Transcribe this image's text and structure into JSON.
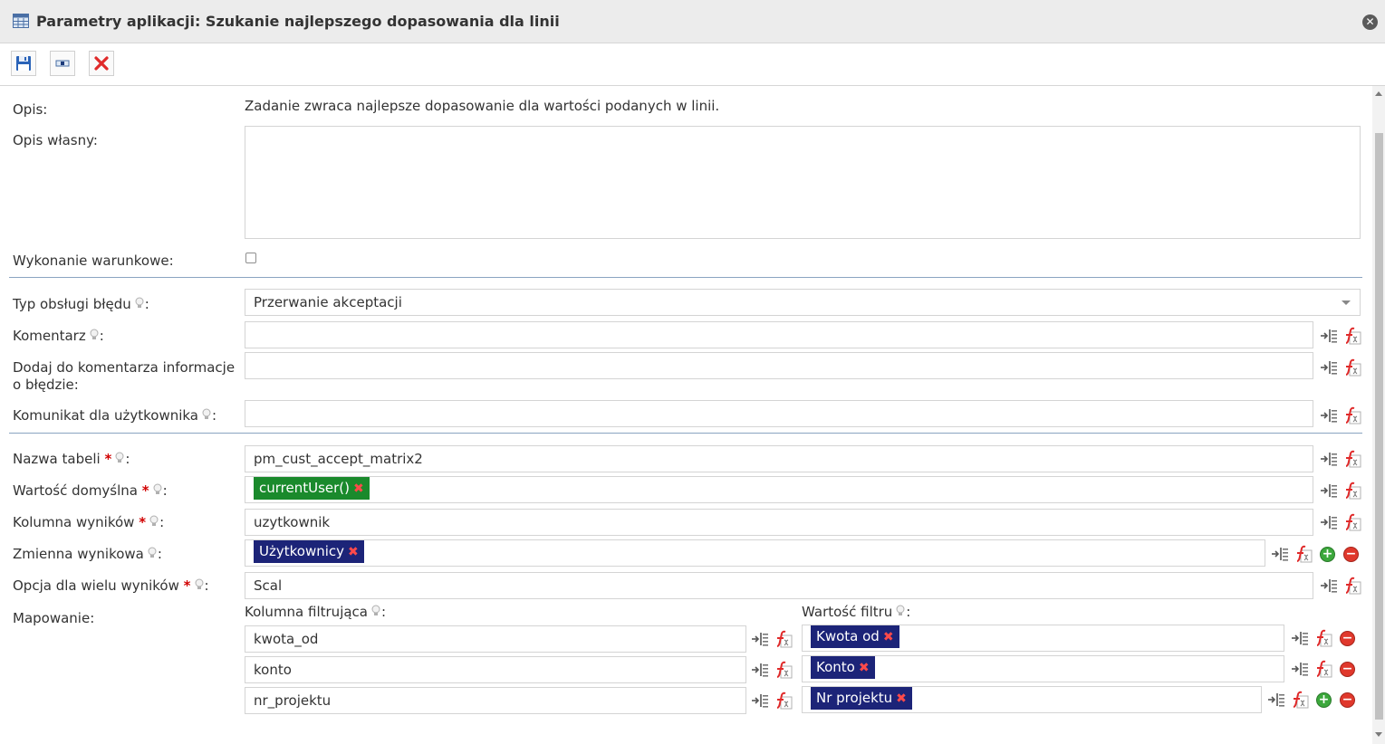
{
  "window": {
    "title": "Parametry aplikacji: Szukanie najlepszego dopasowania dla linii"
  },
  "toolbar": {
    "save": "save-icon",
    "action": "step-icon",
    "cancel": "delete-icon"
  },
  "form": {
    "opis_label": "Opis:",
    "opis_value": "Zadanie zwraca najlepsze dopasowanie dla wartości podanych w linii.",
    "opis_wlasny_label": "Opis własny:",
    "opis_wlasny_value": "",
    "wykonanie_label": "Wykonanie warunkowe:",
    "typ_bledu_label": "Typ obsługi błędu",
    "typ_bledu_value": "Przerwanie akceptacji",
    "komentarz_label": "Komentarz",
    "komentarz_value": "",
    "dodaj_label": "Dodaj do komentarza informacje o błędzie:",
    "dodaj_value": "",
    "komunikat_label": "Komunikat dla użytkownika",
    "komunikat_value": "",
    "nazwa_tabeli_label": "Nazwa tabeli",
    "nazwa_tabeli_value": "pm_cust_accept_matrix2",
    "wartosc_domyslna_label": "Wartość domyślna",
    "wartosc_domyslna_tag": "currentUser()",
    "kolumna_wynikow_label": "Kolumna wyników",
    "kolumna_wynikow_value": "uzytkownik",
    "zmienna_wynikowa_label": "Zmienna wynikowa",
    "zmienna_wynikowa_tag": "Użytkownicy",
    "opcja_label": "Opcja dla wielu wyników",
    "opcja_value": "Scal",
    "mapowanie_label": "Mapowanie:",
    "kolumna_filtrujaca_label": "Kolumna filtrująca",
    "wartosc_filtru_label": "Wartość filtru",
    "colon": ":",
    "required_mark": "*",
    "mapping_rows": [
      {
        "column": "kwota_od",
        "value": "Kwota od"
      },
      {
        "column": "konto",
        "value": "Konto"
      },
      {
        "column": "nr_projektu",
        "value": "Nr projektu"
      }
    ]
  },
  "colors": {
    "green_tag": "#1a8a2c",
    "navy_tag": "#1c2478",
    "required": "#d10000",
    "separator": "#8aa4c1"
  }
}
